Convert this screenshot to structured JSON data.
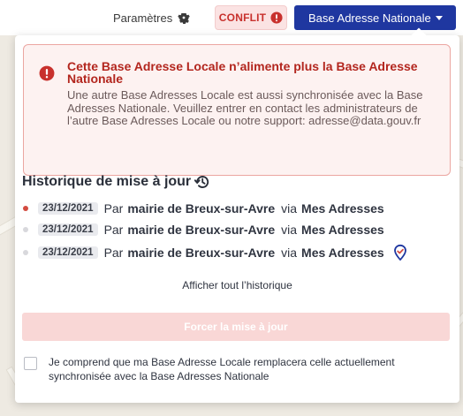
{
  "topbar": {
    "params_label": "Paramètres",
    "conflict_label": "CONFLIT",
    "ban_button_label": "Base Adresse Nationale"
  },
  "alert": {
    "title": "Cette Base Adresse Locale n’alimente plus la Base Adresse Nationale",
    "body": "Une autre Base Adresses Locale est aussi synchronisée avec la Base Adresses Nationale. Veuillez entrer en contact les administrateurs de l’autre Base Adresses Locale ou notre support: adresse@data.gouv.fr"
  },
  "history": {
    "title": "Historique de mise à jour",
    "entries": [
      {
        "date": "23/12/2021",
        "par": "Par",
        "author": "mairie de Breux-sur-Avre",
        "via": "via",
        "tool": "Mes Adresses",
        "active": true
      },
      {
        "date": "23/12/2021",
        "par": "Par",
        "author": "mairie de Breux-sur-Avre",
        "via": "via",
        "tool": "Mes Adresses",
        "active": false
      },
      {
        "date": "23/12/2021",
        "par": "Par",
        "author": "mairie de Breux-sur-Avre",
        "via": "via",
        "tool": "Mes Adresses",
        "active": false
      }
    ],
    "show_all_label": "Afficher tout l’historique"
  },
  "force_button_label": "Forcer la mise à jour",
  "consent_text": "Je comprend que ma Base Adresse Locale remplacera celle actuellement synchronisée avec la Base Adresses Nationale",
  "colors": {
    "primary": "#1f37a0",
    "danger": "#c8312d",
    "alert_bg": "#fdf2f1",
    "force_btn_bg": "#f9d7d6"
  }
}
